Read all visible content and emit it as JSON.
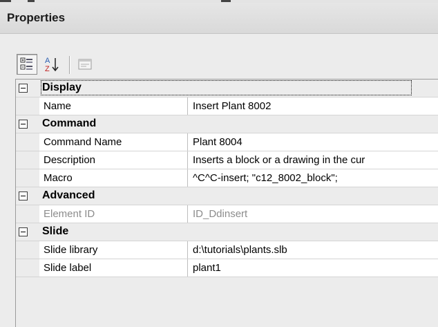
{
  "panel": {
    "title": "Properties"
  },
  "toolbar": {
    "categorized_icon": "categorized-icon",
    "alphabetical_icon": "alphabetical-az-icon",
    "property_pages_icon": "property-pages-icon"
  },
  "categories": [
    {
      "label": "Display",
      "properties": [
        {
          "name": "Name",
          "value": "Insert Plant 8002"
        }
      ]
    },
    {
      "label": "Command",
      "properties": [
        {
          "name": "Command Name",
          "value": "Plant 8004"
        },
        {
          "name": "Description",
          "value": "Inserts a block or a drawing in the cur"
        },
        {
          "name": "Macro",
          "value": "^C^C-insert; \"c12_8002_block\";"
        }
      ]
    },
    {
      "label": "Advanced",
      "properties": [
        {
          "name": "Element ID",
          "value": "ID_Ddinsert",
          "readonly": true
        }
      ]
    },
    {
      "label": "Slide",
      "properties": [
        {
          "name": "Slide library",
          "value": "d:\\tutorials\\plants.slb"
        },
        {
          "name": "Slide label",
          "value": "plant1"
        }
      ]
    }
  ],
  "colors": {
    "readonly_text": "#8c8c8c",
    "category_bg": "#ececec",
    "property_bg": "#ffffff"
  }
}
